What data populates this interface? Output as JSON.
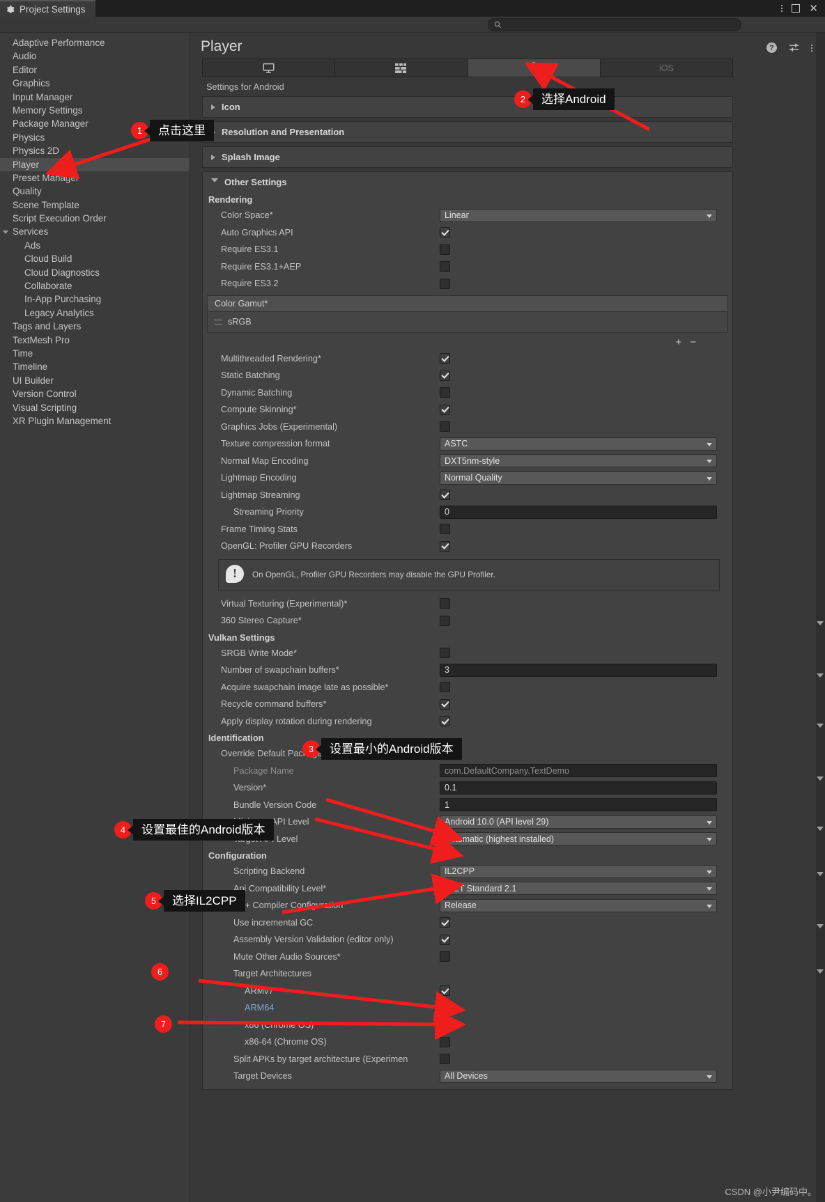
{
  "window": {
    "tab_title": "Project Settings",
    "gear_icon": "gear-icon",
    "kebab_icon": "kebab-menu-icon",
    "maximize_icon": "maximize-icon",
    "close_icon": "close-icon",
    "close_glyph": "✕"
  },
  "search": {
    "value": "",
    "placeholder": "",
    "icon": "search-icon"
  },
  "sidebar": {
    "items": [
      {
        "label": "Adaptive Performance",
        "indent": 0,
        "selected": false
      },
      {
        "label": "Audio",
        "indent": 0,
        "selected": false
      },
      {
        "label": "Editor",
        "indent": 0,
        "selected": false
      },
      {
        "label": "Graphics",
        "indent": 0,
        "selected": false
      },
      {
        "label": "Input Manager",
        "indent": 0,
        "selected": false
      },
      {
        "label": "Memory Settings",
        "indent": 0,
        "selected": false
      },
      {
        "label": "Package Manager",
        "indent": 0,
        "selected": false
      },
      {
        "label": "Physics",
        "indent": 0,
        "selected": false
      },
      {
        "label": "Physics 2D",
        "indent": 0,
        "selected": false
      },
      {
        "label": "Player",
        "indent": 0,
        "selected": true
      },
      {
        "label": "Preset Manager",
        "indent": 0,
        "selected": false
      },
      {
        "label": "Quality",
        "indent": 0,
        "selected": false
      },
      {
        "label": "Scene Template",
        "indent": 0,
        "selected": false
      },
      {
        "label": "Script Execution Order",
        "indent": 0,
        "selected": false
      },
      {
        "label": "Services",
        "indent": 0,
        "selected": false,
        "expanded": true
      },
      {
        "label": "Ads",
        "indent": 1,
        "selected": false
      },
      {
        "label": "Cloud Build",
        "indent": 1,
        "selected": false
      },
      {
        "label": "Cloud Diagnostics",
        "indent": 1,
        "selected": false
      },
      {
        "label": "Collaborate",
        "indent": 1,
        "selected": false
      },
      {
        "label": "In-App Purchasing",
        "indent": 1,
        "selected": false
      },
      {
        "label": "Legacy Analytics",
        "indent": 1,
        "selected": false
      },
      {
        "label": "Tags and Layers",
        "indent": 0,
        "selected": false
      },
      {
        "label": "TextMesh Pro",
        "indent": 0,
        "selected": false
      },
      {
        "label": "Time",
        "indent": 0,
        "selected": false
      },
      {
        "label": "Timeline",
        "indent": 0,
        "selected": false
      },
      {
        "label": "UI Builder",
        "indent": 0,
        "selected": false
      },
      {
        "label": "Version Control",
        "indent": 0,
        "selected": false
      },
      {
        "label": "Visual Scripting",
        "indent": 0,
        "selected": false
      },
      {
        "label": "XR Plugin Management",
        "indent": 0,
        "selected": false
      }
    ]
  },
  "pane": {
    "title": "Player",
    "help_icon": "help-icon",
    "preferences_icon": "preferences-sliders-icon",
    "more_icon": "kebab-menu-icon",
    "platform_tabs": [
      {
        "icon": "monitor-icon",
        "label": "",
        "active": false
      },
      {
        "icon": "webgl-icon",
        "label": "",
        "active": false
      },
      {
        "icon": "android-icon",
        "label": "",
        "active": true
      },
      {
        "icon": "ios-icon",
        "label": "iOS",
        "active": false
      }
    ],
    "settings_for": "Settings for Android",
    "foldouts": [
      {
        "label": "Icon",
        "open": false
      },
      {
        "label": "Resolution and Presentation",
        "open": false
      },
      {
        "label": "Splash Image",
        "open": false
      }
    ],
    "other_settings": {
      "label": "Other Settings",
      "open": true,
      "groups": [
        {
          "name": "Rendering",
          "rows": [
            {
              "label": "Color Space*",
              "type": "dropdown",
              "value": "Linear",
              "indent": 0
            },
            {
              "label": "Auto Graphics API",
              "type": "checkbox",
              "checked": true,
              "indent": 0
            },
            {
              "label": "Require ES3.1",
              "type": "checkbox",
              "checked": false,
              "indent": 0
            },
            {
              "label": "Require ES3.1+AEP",
              "type": "checkbox",
              "checked": false,
              "indent": 0
            },
            {
              "label": "Require ES3.2",
              "type": "checkbox",
              "checked": false,
              "indent": 0
            }
          ]
        }
      ],
      "color_gamut": {
        "header": "Color Gamut*",
        "entries": [
          "sRGB"
        ],
        "add_label": "+",
        "remove_label": "−"
      },
      "rendering_rows2": [
        {
          "label": "Multithreaded Rendering*",
          "type": "checkbox",
          "checked": true
        },
        {
          "label": "Static Batching",
          "type": "checkbox",
          "checked": true
        },
        {
          "label": "Dynamic Batching",
          "type": "checkbox",
          "checked": false
        },
        {
          "label": "Compute Skinning*",
          "type": "checkbox",
          "checked": true
        },
        {
          "label": "Graphics Jobs (Experimental)",
          "type": "checkbox",
          "checked": false
        },
        {
          "label": "Texture compression format",
          "type": "dropdown",
          "value": "ASTC"
        },
        {
          "label": "Normal Map Encoding",
          "type": "dropdown",
          "value": "DXT5nm-style"
        },
        {
          "label": "Lightmap Encoding",
          "type": "dropdown",
          "value": "Normal Quality"
        },
        {
          "label": "Lightmap Streaming",
          "type": "checkbox",
          "checked": true
        },
        {
          "label": "Streaming Priority",
          "type": "textfield",
          "value": "0",
          "indent": 1
        },
        {
          "label": "Frame Timing Stats",
          "type": "checkbox",
          "checked": false
        },
        {
          "label": "OpenGL: Profiler GPU Recorders",
          "type": "checkbox",
          "checked": true
        }
      ],
      "help_message": "On OpenGL, Profiler GPU Recorders may disable the GPU Profiler.",
      "rendering_rows3": [
        {
          "label": "Virtual Texturing (Experimental)*",
          "type": "checkbox",
          "checked": false
        },
        {
          "label": "360 Stereo Capture*",
          "type": "checkbox",
          "checked": false
        }
      ],
      "vulkan": {
        "name": "Vulkan Settings",
        "rows": [
          {
            "label": "SRGB Write Mode*",
            "type": "checkbox",
            "checked": false
          },
          {
            "label": "Number of swapchain buffers*",
            "type": "textfield",
            "value": "3"
          },
          {
            "label": "Acquire swapchain image late as possible*",
            "type": "checkbox",
            "checked": false
          },
          {
            "label": "Recycle command buffers*",
            "type": "checkbox",
            "checked": true
          },
          {
            "label": "Apply display rotation during rendering",
            "type": "checkbox",
            "checked": true
          }
        ]
      },
      "identification": {
        "name": "Identification",
        "rows": [
          {
            "label": "Override Default Package Name",
            "type": "checkbox",
            "checked": false
          },
          {
            "label": "Package Name",
            "type": "textfield",
            "value": "com.DefaultCompany.TextDemo",
            "dim": true,
            "indent": 1
          },
          {
            "label": "Version*",
            "type": "textfield",
            "value": "0.1",
            "indent": 1
          },
          {
            "label": "Bundle Version Code",
            "type": "textfield",
            "value": "1",
            "indent": 1
          },
          {
            "label": "Minimum API Level",
            "type": "dropdown",
            "value": "Android 10.0 (API level 29)",
            "indent": 1
          },
          {
            "label": "Target API Level",
            "type": "dropdown",
            "value": "Automatic (highest installed)",
            "indent": 1
          }
        ]
      },
      "configuration": {
        "name": "Configuration",
        "rows": [
          {
            "label": "Scripting Backend",
            "type": "dropdown",
            "value": "IL2CPP",
            "indent": 1
          },
          {
            "label": "Api Compatibility Level*",
            "type": "dropdown",
            "value": ".NET Standard 2.1",
            "indent": 1
          },
          {
            "label": "C++ Compiler Configuration",
            "type": "dropdown",
            "value": "Release",
            "indent": 1
          },
          {
            "label": "Use incremental GC",
            "type": "checkbox",
            "checked": true,
            "indent": 1
          },
          {
            "label": "Assembly Version Validation (editor only)",
            "type": "checkbox",
            "checked": true,
            "indent": 1
          },
          {
            "label": "Mute Other Audio Sources*",
            "type": "checkbox",
            "checked": false,
            "indent": 1
          },
          {
            "label": "Target Architectures",
            "type": "header",
            "indent": 1
          },
          {
            "label": "ARMv7",
            "type": "checkbox",
            "checked": true,
            "indent": 2
          },
          {
            "label": "ARM64",
            "type": "checkbox",
            "checked": true,
            "indent": 2,
            "highlight": true
          },
          {
            "label": "x86 (Chrome OS)",
            "type": "checkbox",
            "checked": false,
            "indent": 2
          },
          {
            "label": "x86-64 (Chrome OS)",
            "type": "checkbox",
            "checked": false,
            "indent": 2
          },
          {
            "label": "Split APKs by target architecture (Experimen",
            "type": "checkbox",
            "checked": false,
            "indent": 1
          },
          {
            "label": "Target Devices",
            "type": "dropdown",
            "value": "All Devices",
            "indent": 1
          }
        ]
      }
    }
  },
  "annotations": [
    {
      "number": "1",
      "text": "点击这里"
    },
    {
      "number": "2",
      "text": "选择Android"
    },
    {
      "number": "3",
      "text": "设置最小的Android版本"
    },
    {
      "number": "4",
      "text": "设置最佳的Android版本"
    },
    {
      "number": "5",
      "text": "选择IL2CPP"
    },
    {
      "number": "6",
      "text": ""
    },
    {
      "number": "7",
      "text": ""
    }
  ],
  "watermark": "CSDN @小尹编码中。",
  "colors": {
    "accent_red": "#f01d1d",
    "panel": "#383838",
    "sidebar": "#3b3b3b",
    "selection": "#4d4d4d"
  }
}
